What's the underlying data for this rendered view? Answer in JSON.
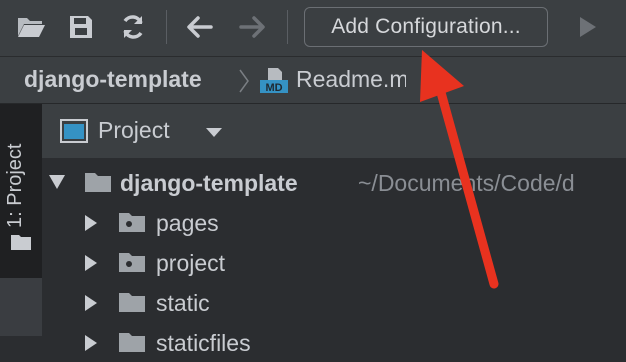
{
  "toolbar": {
    "open_icon": "folder-open-icon",
    "save_icon": "save-icon",
    "sync_icon": "sync-icon",
    "back_icon": "arrow-left-icon",
    "forward_icon": "arrow-right-icon",
    "run_icon": "play-icon",
    "config_label": "Add Configuration..."
  },
  "breadcrumb": {
    "project": "django-template",
    "file": "Readme.md",
    "file_icon_text": "MD"
  },
  "side_tab": {
    "label": "1: Project"
  },
  "panel": {
    "title": "Project"
  },
  "tree": {
    "root": {
      "label": "django-template",
      "path": "~/Documents/Code/d"
    },
    "items": [
      {
        "label": "pages"
      },
      {
        "label": "project"
      },
      {
        "label": "static"
      },
      {
        "label": "staticfiles"
      }
    ]
  },
  "colors": {
    "accent_arrow": "#e8321f",
    "folder": "#9ea3a8",
    "md_icon": "#3592c4"
  }
}
